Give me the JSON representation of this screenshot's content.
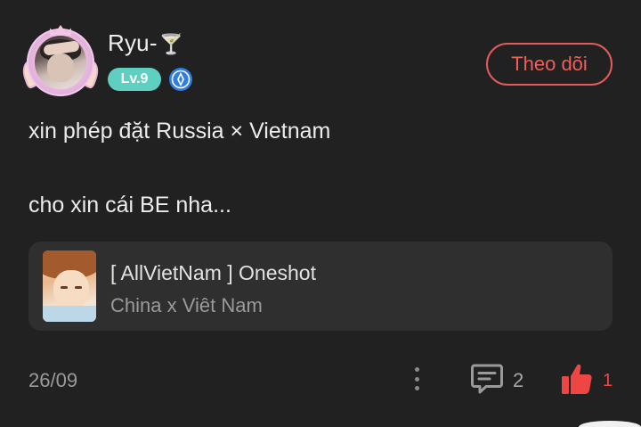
{
  "author": {
    "name": "Ryu-",
    "name_emoji": "🍸",
    "level": "Lv.9",
    "avatar_icon": "user-avatar",
    "rank_icon": "blue-rank-badge-icon"
  },
  "actions": {
    "follow_label": "Theo dõi"
  },
  "post": {
    "line1": "xin phép đặt Russia × Vietnam",
    "line2": "cho xin cái BE nha..."
  },
  "linked_story": {
    "title": "[ AllVietNam ] Oneshot",
    "subtitle": "China x Viêt Nam"
  },
  "footer": {
    "date": "26/09",
    "comment_count": "2",
    "like_count": "1"
  },
  "colors": {
    "background": "#212121",
    "accent_red": "#ee4545",
    "level_badge": "#5ecfc0",
    "card_background": "#2f2f2f"
  }
}
